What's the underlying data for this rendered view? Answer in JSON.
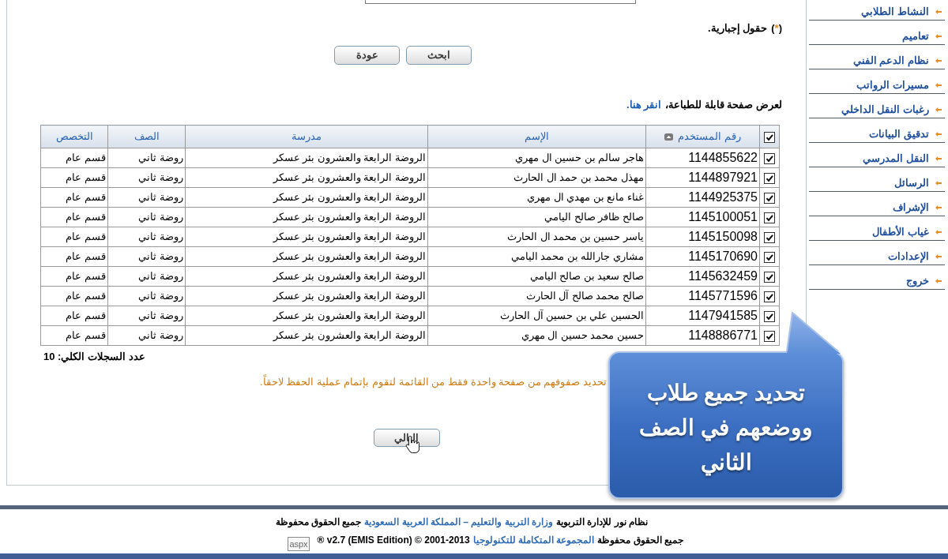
{
  "sidebar": {
    "items": [
      {
        "label": "النشاط الطلابي"
      },
      {
        "label": "تعاميم"
      },
      {
        "label": "نظام الدعم الفني"
      },
      {
        "label": "مسيرات الرواتب"
      },
      {
        "label": "رغبات النقل الداخلي"
      },
      {
        "label": "تدقيق البيانات"
      },
      {
        "label": "النقل المدرسي"
      },
      {
        "label": "الرسائل"
      },
      {
        "label": "الإشراف"
      },
      {
        "label": "غياب الأطفال"
      },
      {
        "label": "الإعدادات"
      },
      {
        "label": "خروج"
      }
    ]
  },
  "required_note": {
    "prefix": "(",
    "mark": "*",
    "suffix": ")",
    "text": "حقول إجبارية."
  },
  "buttons": [
    {
      "label": "ابحث"
    },
    {
      "label": "عودة"
    }
  ],
  "print_hint": {
    "text": "لعرض صفحة قابلة للطباعة،",
    "link": "انقر هنا."
  },
  "table": {
    "select_all_checked": true,
    "columns": [
      {
        "label": "رقم المستخدم",
        "sorted": true
      },
      {
        "label": "الإسم",
        "sorted": false
      },
      {
        "label": "مدرسة",
        "sorted": false
      },
      {
        "label": "الصف",
        "sorted": false
      },
      {
        "label": "التخصص",
        "sorted": false
      }
    ],
    "rows": [
      {
        "checked": true,
        "user_id": "1144855622",
        "name": "هاجر سالم بن حسين ال مهري",
        "school": "الروضة الرابعة والعشرون بئر عسكر",
        "grade": "روضة ثاني",
        "specialization": "قسم عام"
      },
      {
        "checked": true,
        "user_id": "1144897921",
        "name": "مهذل محمد بن حمد ال الحارث",
        "school": "الروضة الرابعة والعشرون بئر عسكر",
        "grade": "روضة ثاني",
        "specialization": "قسم عام"
      },
      {
        "checked": true,
        "user_id": "1144925375",
        "name": "غناء مانع بن مهدي ال مهري",
        "school": "الروضة الرابعة والعشرون بئر عسكر",
        "grade": "روضة ثاني",
        "specialization": "قسم عام"
      },
      {
        "checked": true,
        "user_id": "1145100051",
        "name": "صالح ظافر صالح اليامي",
        "school": "الروضة الرابعة والعشرون بئر عسكر",
        "grade": "روضة ثاني",
        "specialization": "قسم عام"
      },
      {
        "checked": true,
        "user_id": "1145150098",
        "name": "ياسر حسين بن محمد ال الحارث",
        "school": "الروضة الرابعة والعشرون بئر عسكر",
        "grade": "روضة ثاني",
        "specialization": "قسم عام"
      },
      {
        "checked": true,
        "user_id": "1145170690",
        "name": "مشاري جارالله بن محمد اليامي",
        "school": "الروضة الرابعة والعشرون بئر عسكر",
        "grade": "روضة ثاني",
        "specialization": "قسم عام"
      },
      {
        "checked": true,
        "user_id": "1145632459",
        "name": "صالح سعيد بن صالح اليامي",
        "school": "الروضة الرابعة والعشرون بئر عسكر",
        "grade": "روضة ثاني",
        "specialization": "قسم عام"
      },
      {
        "checked": true,
        "user_id": "1145771596",
        "name": "صالح محمد صالح آل الحارث",
        "school": "الروضة الرابعة والعشرون بئر عسكر",
        "grade": "روضة ثاني",
        "specialization": "قسم عام"
      },
      {
        "checked": true,
        "user_id": "1147941585",
        "name": "الحسين علي بن حسين آل الحارث",
        "school": "الروضة الرابعة والعشرون بئر عسكر",
        "grade": "روضة ثاني",
        "specialization": "قسم عام"
      },
      {
        "checked": true,
        "user_id": "1148886771",
        "name": "حسين محمد حسين ال مهري",
        "school": "الروضة الرابعة والعشرون بئر عسكر",
        "grade": "روضة ثاني",
        "specialization": "قسم عام"
      }
    ]
  },
  "record_count": "عدد السجلات الكلي: 10",
  "notice": "تحديد صفوفهم من صفحة واحدة فقط من القائمة لتقوم بإتمام عملية الحفظ لاحقاً.",
  "next_button": {
    "label": "التالي"
  },
  "callout": {
    "lines": [
      "تحديد جميع طلاب",
      "ووضعهم في الصف",
      "الثاني"
    ]
  },
  "footer": {
    "lines": [
      [
        {
          "kind": "plain",
          "text": "نظام نور للإدارة التربوية"
        },
        {
          "kind": "link",
          "text": "وزارة التربية والتعليم – المملكة العربية السعودية"
        },
        {
          "kind": "plain",
          "text": "جميع الحقوق محفوظة"
        }
      ],
      [
        {
          "kind": "plain",
          "text": "جميع الحقوق محفوظة"
        },
        {
          "kind": "link",
          "text": "المجموعة المتكاملة للتكنولوجيا"
        },
        {
          "kind": "latin",
          "text": "® v2.7 (EMIS Edition) © 2001-2013"
        }
      ]
    ]
  },
  "status_tooltip": "aspx"
}
